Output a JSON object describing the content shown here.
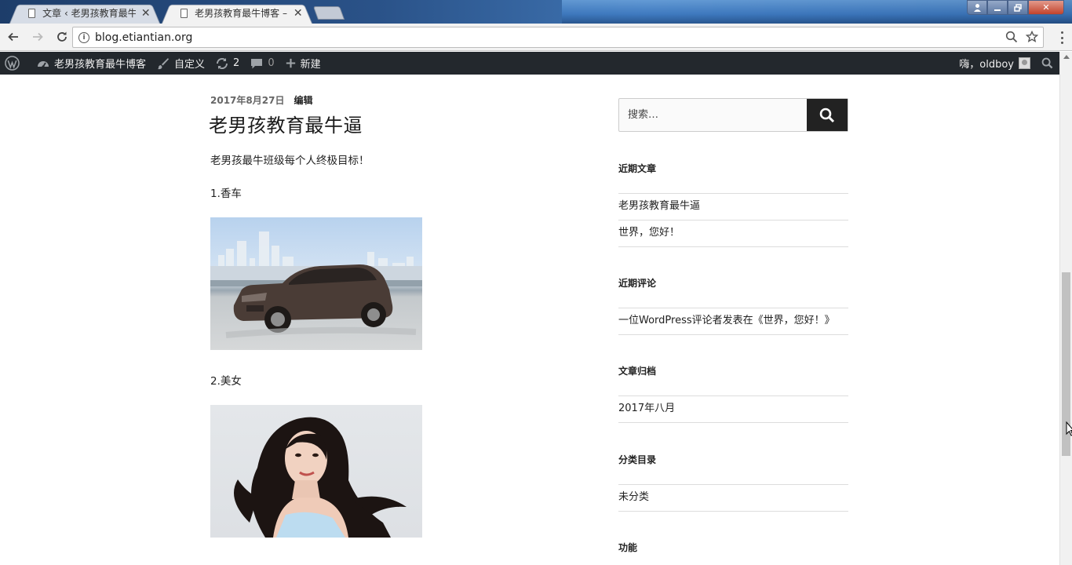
{
  "browser": {
    "tabs": [
      {
        "label": "文章 ‹ 老男孩教育最牛博",
        "active": false
      },
      {
        "label": "老男孩教育最牛博客 – 又",
        "active": true
      }
    ],
    "url": "blog.etiantian.org"
  },
  "adminbar": {
    "site_name": "老男孩教育最牛博客",
    "customize": "自定义",
    "updates_count": "2",
    "comments_count": "0",
    "new_label": "新建",
    "greeting": "嗨，oldboy"
  },
  "post": {
    "date": "2017年8月27日",
    "edit": "编辑",
    "title": "老男孩教育最牛逼",
    "intro": "老男孩最牛班级每个人终极目标！",
    "item1": "1.香车",
    "item2": "2.美女"
  },
  "sidebar": {
    "search_placeholder": "搜索…",
    "recent_posts_title": "近期文章",
    "recent_posts": [
      "老男孩教育最牛逼",
      "世界，您好！"
    ],
    "recent_comments_title": "近期评论",
    "recent_comments": [
      "一位WordPress评论者发表在《世界，您好！》"
    ],
    "archives_title": "文章归档",
    "archives": [
      "2017年八月"
    ],
    "categories_title": "分类目录",
    "categories": [
      "未分类"
    ],
    "meta_title": "功能"
  },
  "colors": {
    "adminbar_bg": "#23282d",
    "search_button_bg": "#222222",
    "divider": "#dddddd"
  }
}
